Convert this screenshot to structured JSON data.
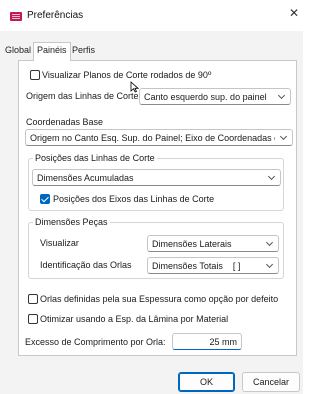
{
  "window": {
    "title": "Preferências",
    "close_glyph": "✕",
    "icon": "app-icon"
  },
  "tabs": [
    {
      "label": "Global",
      "active": false
    },
    {
      "label": "Painéis",
      "active": true
    },
    {
      "label": "Perfis",
      "active": false
    }
  ],
  "panel": {
    "visualizar_planos": {
      "label": "Visualizar Planos de Corte rodados de 90º",
      "checked": false
    },
    "origem_linhas": {
      "label": "Origem das Linhas de Corte",
      "value": "Canto esquerdo sup. do painel"
    },
    "coordenadas_base": {
      "label": "Coordenadas Base",
      "value": "Origem no Canto Esq. Sup. do Painel; Eixo de Coordenadas orien"
    },
    "posicoes_group": {
      "title": "Posições das Linhas de Corte",
      "combo_value": "Dimensões Acumuladas",
      "posicoes_eixos": {
        "label": "Posições dos Eixos das Linhas de Corte",
        "checked": true
      }
    },
    "dimensoes_group": {
      "title": "Dimensões Peças",
      "visualizar": {
        "label": "Visualizar",
        "value": "Dimensões Laterais"
      },
      "identificacao": {
        "label": "Identificação das Orlas",
        "value": "Dimensões Totais    [ ]"
      }
    },
    "orlas_espessura": {
      "label": "Orlas definidas pela sua Espessura como opção por defeito",
      "checked": false
    },
    "otimizar": {
      "label": "Otimizar usando a Esp. da Lâmina por Material",
      "checked": false
    },
    "excesso": {
      "label": "Excesso de Comprimento por Orla:",
      "value": "25 mm"
    }
  },
  "buttons": {
    "ok": "OK",
    "cancel": "Cancelar"
  },
  "colors": {
    "accent": "#0067c0",
    "client_bg": "#f3f3f3",
    "panel_bg": "#ffffff",
    "app_icon": "#c2185b"
  }
}
